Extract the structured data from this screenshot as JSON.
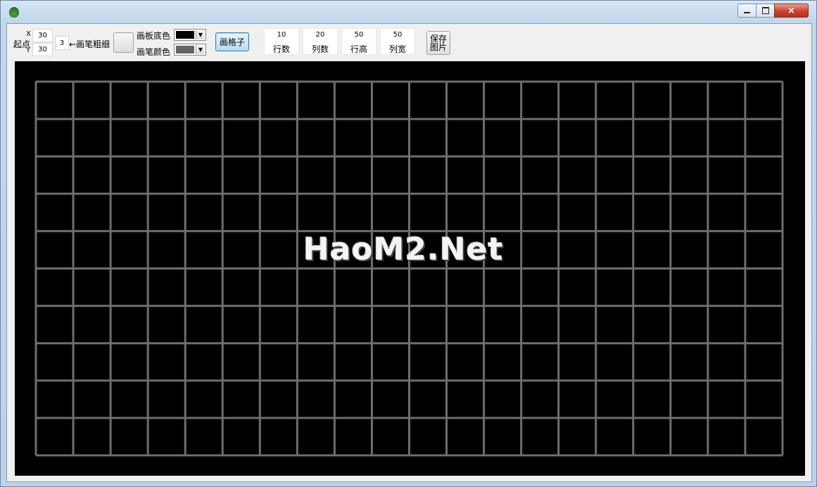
{
  "window": {
    "icon": "money-bag-icon",
    "buttons": {
      "minimize": "minimize-icon",
      "maximize": "restore-icon",
      "close": "×"
    }
  },
  "toolbar": {
    "start_label": "起点",
    "x_label": "X",
    "y_label": "Y",
    "start_x": "30",
    "start_y": "30",
    "pen_width": "3",
    "pen_width_label": "←画笔粗细",
    "board_color_label": "画板底色",
    "pen_color_label": "画笔颜色",
    "board_color": "#000000",
    "pen_color": "#646464",
    "dropdown_arrow": "▼",
    "draw_grid_label": "画格子",
    "params": [
      {
        "value": "10",
        "name": "行数"
      },
      {
        "value": "20",
        "name": "列数"
      },
      {
        "value": "50",
        "name": "行高"
      },
      {
        "value": "50",
        "name": "列宽"
      }
    ],
    "save_line1": "保存",
    "save_line2": "图片"
  },
  "canvas": {
    "background": "#000000",
    "grid_color": "#6e6e6e",
    "rows": 10,
    "cols": 20,
    "watermark": "HaoM2.Net"
  }
}
